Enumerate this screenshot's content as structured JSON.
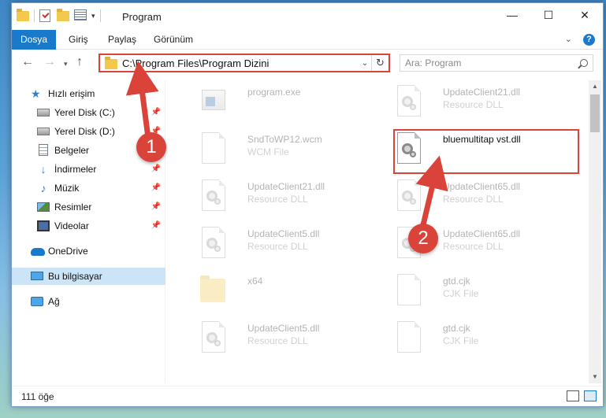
{
  "window": {
    "title": "Program"
  },
  "ribbon": {
    "tabs": [
      "Dosya",
      "Giriş",
      "Paylaş",
      "Görünüm"
    ]
  },
  "nav": {
    "address": "C:\\Program Files\\Program Dizini",
    "search_placeholder": "Ara: Program"
  },
  "sidebar": {
    "items": [
      {
        "label": "Hızlı erişim"
      },
      {
        "label": "Yerel Disk (C:)"
      },
      {
        "label": "Yerel Disk (D:)"
      },
      {
        "label": "Belgeler"
      },
      {
        "label": "İndirmeler"
      },
      {
        "label": "Müzik"
      },
      {
        "label": "Resimler"
      },
      {
        "label": "Videolar"
      },
      {
        "label": "OneDrive"
      },
      {
        "label": "Bu bilgisayar"
      },
      {
        "label": "Ağ"
      }
    ]
  },
  "files": [
    {
      "name": "program.exe",
      "type": ""
    },
    {
      "name": "UpdateClient21.dll",
      "type": "Resource DLL"
    },
    {
      "name": "SndToWP12.wcm",
      "type": "WCM File"
    },
    {
      "name": "bluemultitap vst.dll",
      "type": ""
    },
    {
      "name": "UpdateClient21.dll",
      "type": "Resource DLL"
    },
    {
      "name": "UpdateClient65.dll",
      "type": "Resource DLL"
    },
    {
      "name": "UpdateClient5.dll",
      "type": "Resource DLL"
    },
    {
      "name": "UpdateClient65.dll",
      "type": "Resource DLL"
    },
    {
      "name": "x64",
      "type": ""
    },
    {
      "name": "gtd.cjk",
      "type": "CJK File"
    },
    {
      "name": "UpdateClient5.dll",
      "type": "Resource DLL"
    },
    {
      "name": "gtd.cjk",
      "type": "CJK File"
    }
  ],
  "status": {
    "item_count": "111 öğe"
  },
  "annotations": {
    "step1": "1",
    "step2": "2"
  },
  "colors": {
    "accent": "#1979ca",
    "annotation": "#d9433a",
    "selected": "#cce4f7"
  }
}
